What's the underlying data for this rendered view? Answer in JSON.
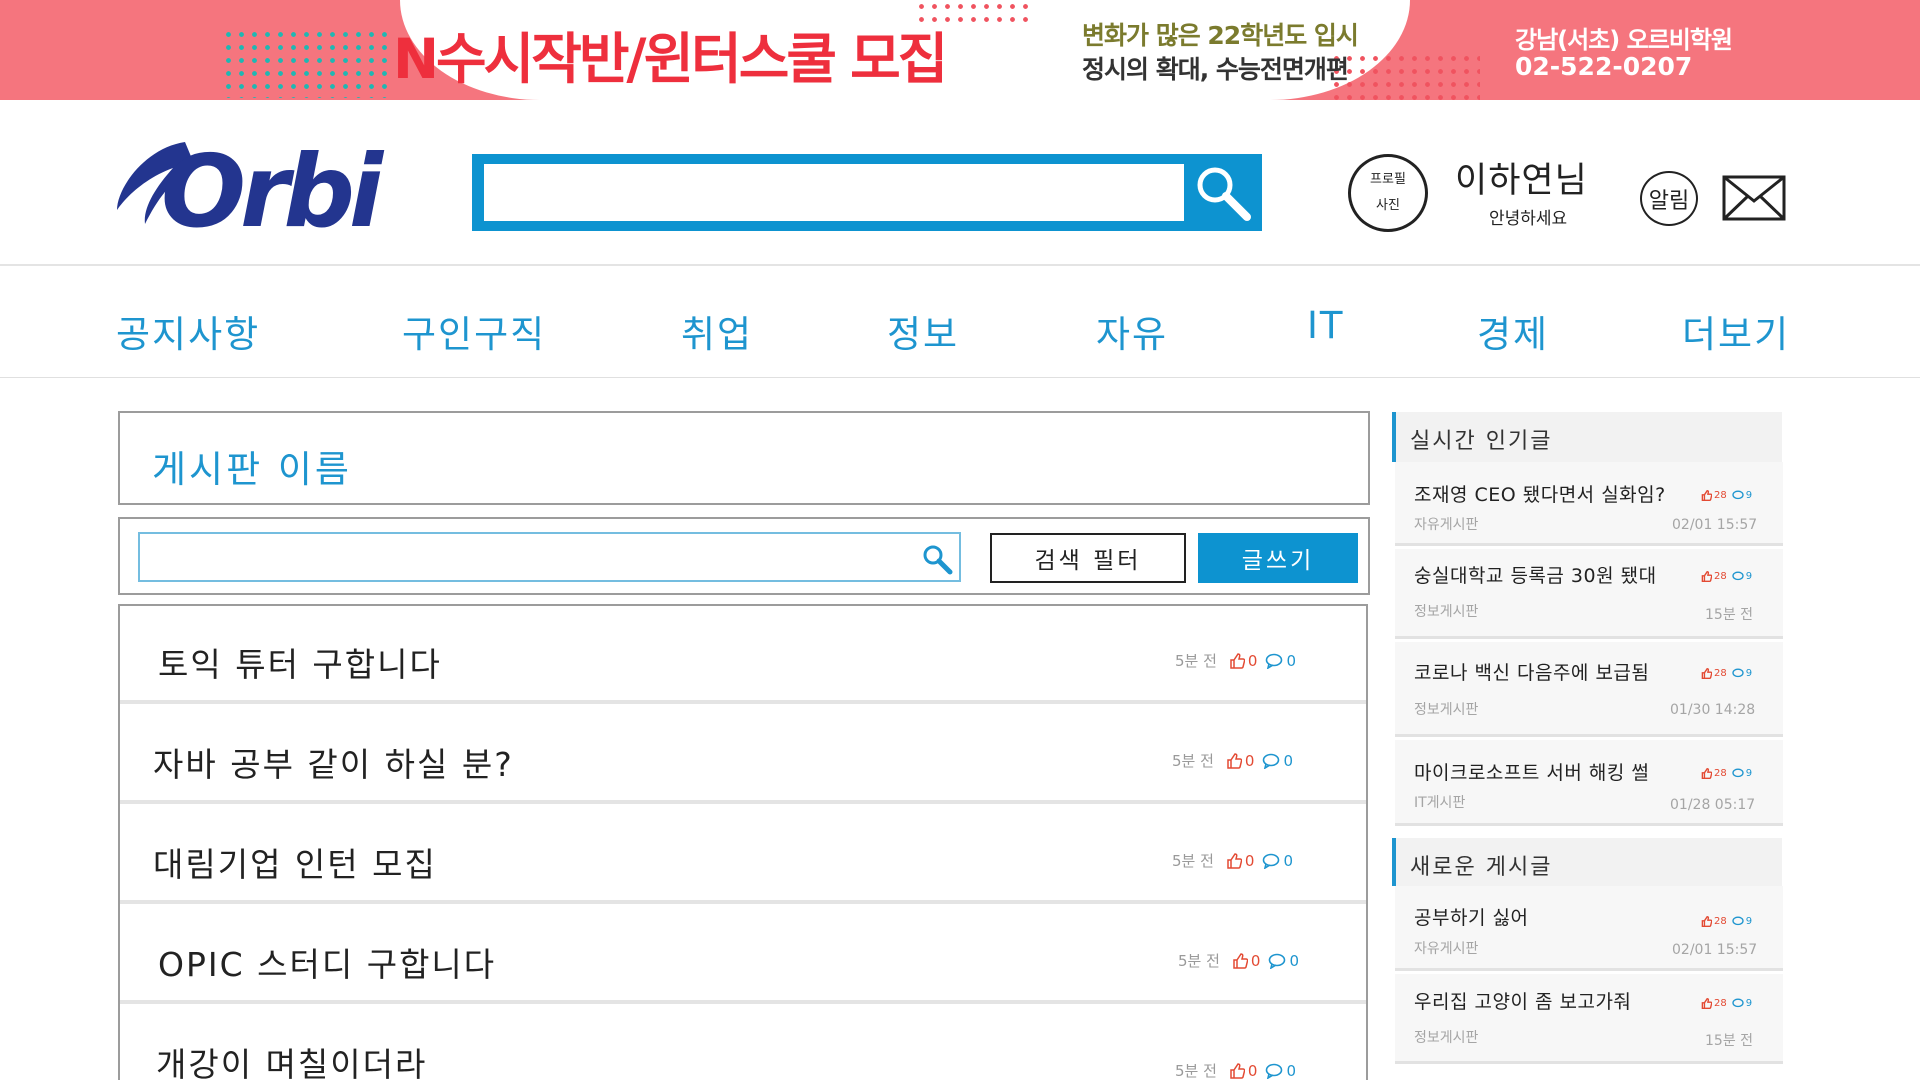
{
  "banner": {
    "headline": "N수시작반/윈터스쿨 모집",
    "sub1": "변화가 많은 22학년도 입시",
    "sub2": "정시의 확대, 수능전면개편",
    "academy": "강남(서초) 오르비학원",
    "phone": "02-522-0207"
  },
  "header": {
    "logo_text": "Orbi",
    "search_value": "",
    "profile_line1": "프로필",
    "profile_line2": "사진",
    "user_name": "이하연님",
    "greeting": "안녕하세요",
    "alarm_label": "알림"
  },
  "nav": {
    "items": [
      "공지사항",
      "구인구직",
      "취업",
      "정보",
      "자유",
      "IT",
      "경제",
      "더보기"
    ]
  },
  "board": {
    "title": "게시판 이름",
    "search_value": "",
    "filter_label": "검색 필터",
    "write_label": "글쓰기"
  },
  "posts": [
    {
      "title": "토익 튜터 구합니다",
      "time": "5분 전",
      "likes": "0",
      "comments": "0"
    },
    {
      "title": "자바 공부 같이 하실 분?",
      "time": "5분 전",
      "likes": "0",
      "comments": "0"
    },
    {
      "title": "대림기업 인턴 모집",
      "time": "5분 전",
      "likes": "0",
      "comments": "0"
    },
    {
      "title": "OPIC 스터디 구합니다",
      "time": "5분 전",
      "likes": "0",
      "comments": "0"
    },
    {
      "title": "개강이 며칠이더라",
      "time": "5분 전",
      "likes": "0",
      "comments": "0"
    }
  ],
  "sidebar": {
    "popular_title": "실시간 인기글",
    "popular": [
      {
        "title": "조재영 CEO 됐다면서 실화임?",
        "category": "자유게시판",
        "time": "02/01 15:57",
        "likes": "28",
        "comments": "9"
      },
      {
        "title": "숭실대학교 등록금 30원 됐대",
        "category": "정보게시판",
        "time": "15분 전",
        "likes": "28",
        "comments": "9"
      },
      {
        "title": "코로나 백신 다음주에 보급됨",
        "category": "정보게시판",
        "time": "01/30 14:28",
        "likes": "28",
        "comments": "9"
      },
      {
        "title": "마이크로소프트 서버 해킹 썰",
        "category": "IT게시판",
        "time": "01/28 05:17",
        "likes": "28",
        "comments": "9"
      }
    ],
    "new_title": "새로운 게시글",
    "new": [
      {
        "title": "공부하기 싫어",
        "category": "자유게시판",
        "time": "02/01 15:57",
        "likes": "28",
        "comments": "9"
      },
      {
        "title": "우리집 고양이 좀 보고가줘",
        "category": "정보게시판",
        "time": "15분 전",
        "likes": "28",
        "comments": "9"
      }
    ]
  },
  "colors": {
    "accent": "#1e95cf",
    "banner": "#f5757e",
    "search_bar": "#0d93d0",
    "like": "#e34a33"
  }
}
